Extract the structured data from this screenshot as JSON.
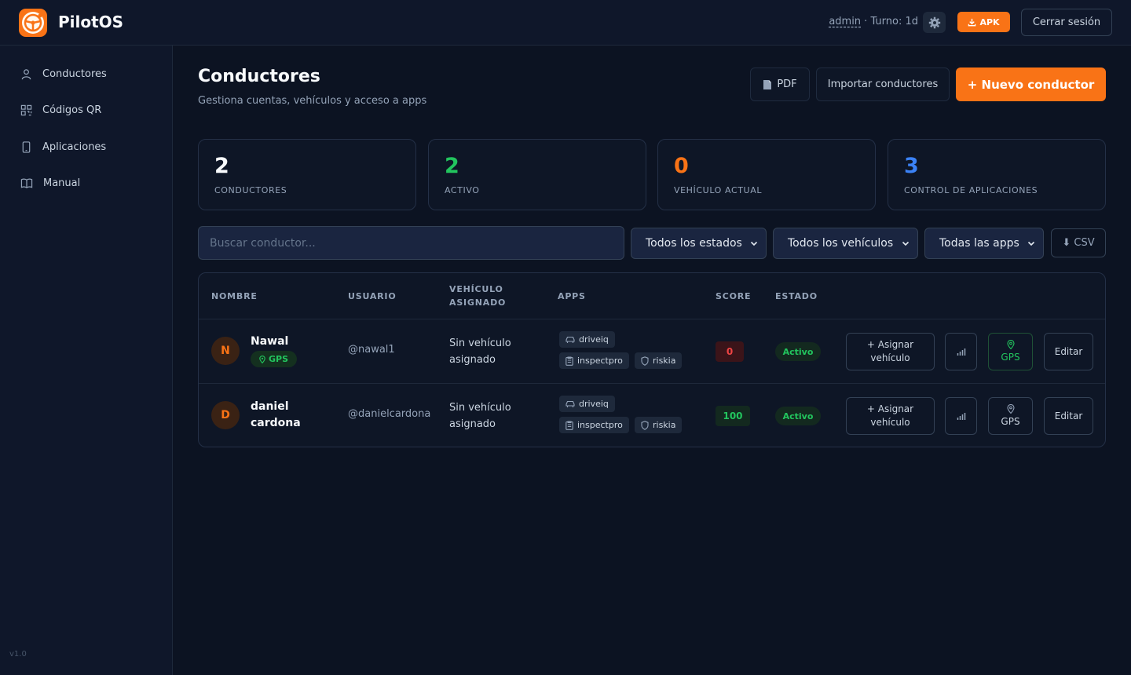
{
  "header": {
    "brand": "PilotOS",
    "user": "admin",
    "shift": " · Turno: 1d",
    "apk_label": "APK",
    "logout_label": "Cerrar sesión"
  },
  "sidebar": {
    "items": [
      {
        "label": "Conductores",
        "icon": "user-icon"
      },
      {
        "label": "Códigos QR",
        "icon": "qr-icon"
      },
      {
        "label": "Aplicaciones",
        "icon": "phone-icon"
      },
      {
        "label": "Manual",
        "icon": "book-icon"
      }
    ],
    "version": "v1.0"
  },
  "page": {
    "title": "Conductores",
    "subtitle": "Gestiona cuentas, vehículos y acceso a apps",
    "pdf_label": "PDF",
    "import_label": "Importar conductores",
    "new_label": "+ Nuevo conductor"
  },
  "stats": [
    {
      "value": "2",
      "label": "CONDUCTORES",
      "color": "#f8fafc"
    },
    {
      "value": "2",
      "label": "ACTIVO",
      "color": "#22c55e"
    },
    {
      "value": "0",
      "label": "VEHÍCULO ACTUAL",
      "color": "#f97316"
    },
    {
      "value": "3",
      "label": "CONTROL DE APLICACIONES",
      "color": "#3b82f6"
    }
  ],
  "filters": {
    "search_placeholder": "Buscar conductor...",
    "status": "Todos los estados",
    "vehicle": "Todos los vehículos",
    "apps": "Todas las apps",
    "csv_label": "⬇ CSV"
  },
  "table": {
    "headers": {
      "name": "NOMBRE",
      "user": "USUARIO",
      "vehicle_1": "VEHÍCULO",
      "vehicle_2": "ASIGNADO",
      "apps": "APPS",
      "score": "SCORE",
      "status": "ESTADO"
    },
    "rows": [
      {
        "initial": "N",
        "name_1": "Nawal",
        "gps_tag": "GPS",
        "username": "@nawal1",
        "vehicle_1": "Sin vehículo",
        "vehicle_2": "asignado",
        "apps": [
          "driveiq",
          "inspectpro",
          "riskia"
        ],
        "score": "0",
        "status": "Activo",
        "assign_1": "+ Asignar",
        "assign_2": "vehículo",
        "gps_label": "GPS",
        "edit_label": "Editar"
      },
      {
        "initial": "D",
        "name_1": "daniel",
        "name_2": "cardona",
        "username": "@danielcardona",
        "vehicle_1": "Sin vehículo",
        "vehicle_2": "asignado",
        "apps": [
          "driveiq",
          "inspectpro",
          "riskia"
        ],
        "score": "100",
        "status": "Activo",
        "assign_1": "+ Asignar",
        "assign_2": "vehículo",
        "gps_label": "GPS",
        "edit_label": "Editar"
      }
    ]
  }
}
